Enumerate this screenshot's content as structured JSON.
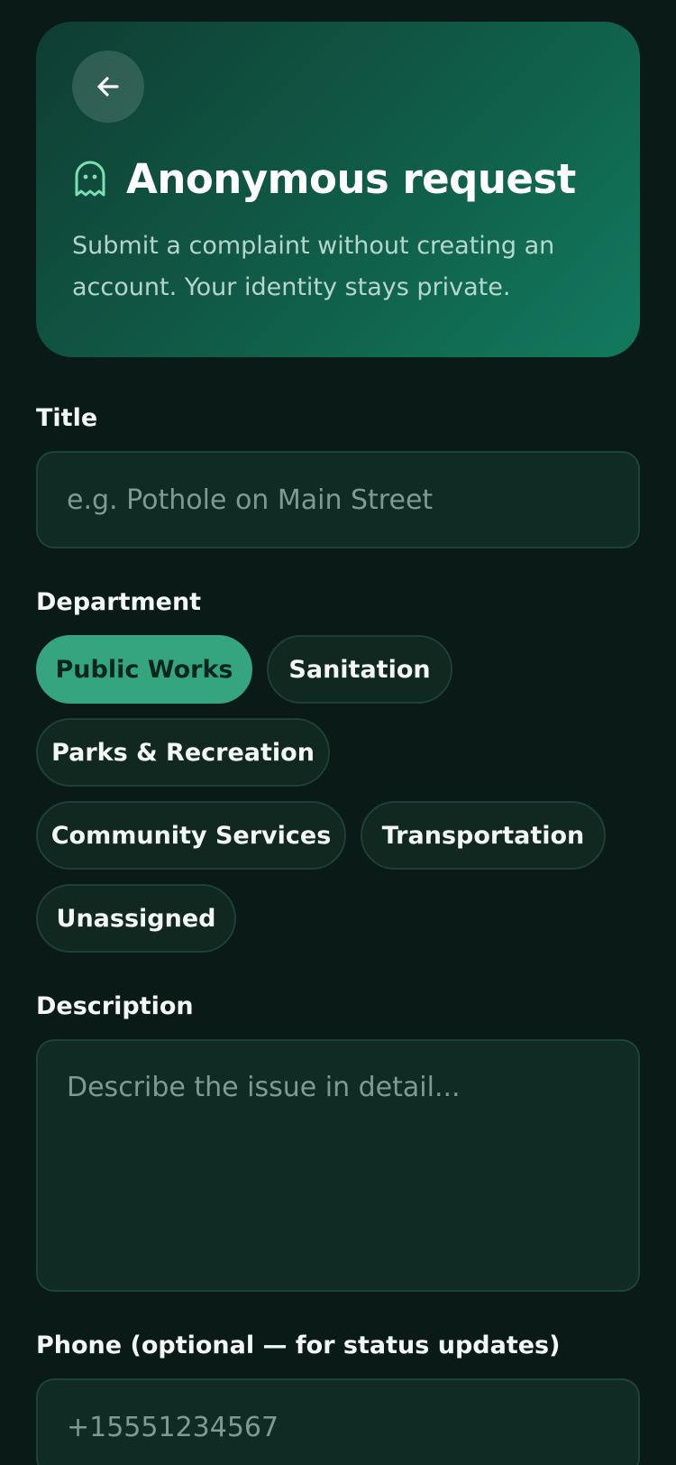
{
  "header": {
    "title": "Anonymous request",
    "subtitle": "Submit a complaint without creating an account. Your identity stays private."
  },
  "form": {
    "title_label": "Title",
    "title_placeholder": "e.g. Pothole on Main Street",
    "department_label": "Department",
    "departments": [
      {
        "label": "Public Works",
        "selected": true
      },
      {
        "label": "Sanitation",
        "selected": false
      },
      {
        "label": "Parks & Recreation",
        "selected": false
      },
      {
        "label": "Community Services",
        "selected": false
      },
      {
        "label": "Transportation",
        "selected": false
      },
      {
        "label": "Unassigned",
        "selected": false
      }
    ],
    "description_label": "Description",
    "description_placeholder": "Describe the issue in detail...",
    "phone_label": "Phone (optional — for status updates)",
    "phone_placeholder": "+15551234567"
  },
  "colors": {
    "background": "#0a1b17",
    "accent": "#35a57f",
    "ghost_icon": "#7be0b3"
  }
}
